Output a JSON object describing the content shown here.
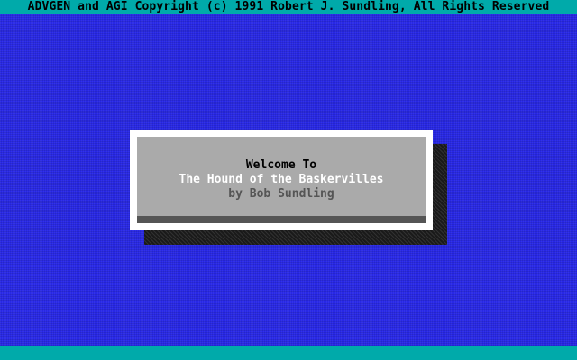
{
  "header": {
    "copyright": "ADVGEN and AGI Copyright (c) 1991 Robert J. Sundling, All Rights Reserved"
  },
  "dialog": {
    "welcome": "Welcome To",
    "game_title": "The Hound of the Baskervilles",
    "author": "by Bob Sundling"
  },
  "colors": {
    "background": "#2828e6",
    "status_bar": "#00aaaa",
    "dialog_face": "#aaaaaa",
    "dialog_highlight": "#ffffff",
    "dialog_lowlight": "#555555"
  }
}
